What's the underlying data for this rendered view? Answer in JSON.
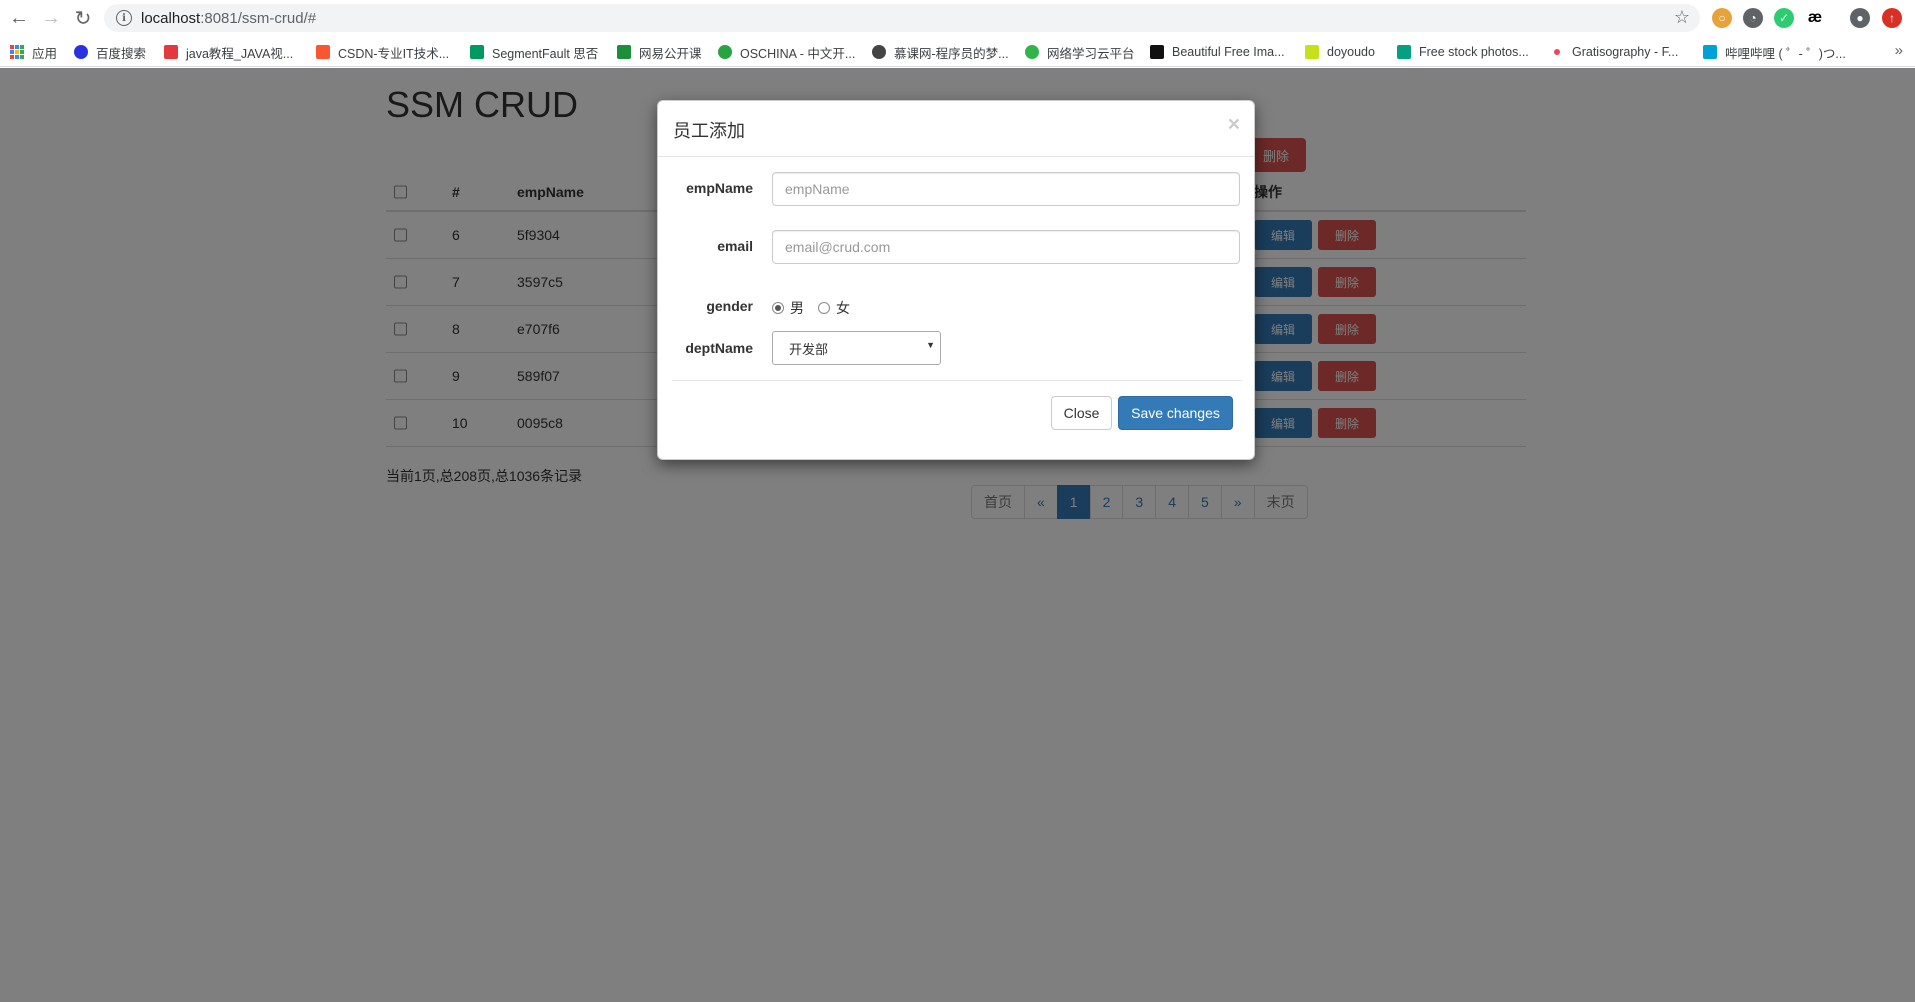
{
  "browser": {
    "url_host": "localhost",
    "url_path": ":8081/ssm-crud/#",
    "bookmarks": [
      {
        "label": "应用",
        "color": "#4285f4"
      },
      {
        "label": "百度搜索",
        "color": "#2932e1"
      },
      {
        "label": "java教程_JAVA视...",
        "color": "#e4393c"
      },
      {
        "label": "CSDN-专业IT技术...",
        "color": "#fc5531"
      },
      {
        "label": "SegmentFault 思否",
        "color": "#009a61"
      },
      {
        "label": "网易公开课",
        "color": "#1d8f3a"
      },
      {
        "label": "OSCHINA - 中文开...",
        "color": "#27a33f"
      },
      {
        "label": "慕课网-程序员的梦...",
        "color": "#444444"
      },
      {
        "label": "网络学习云平台",
        "color": "#31b44a"
      },
      {
        "label": "Beautiful Free Ima...",
        "color": "#111111"
      },
      {
        "label": "doyoudo",
        "color": "#c6e01c"
      },
      {
        "label": "Free stock photos...",
        "color": "#05a081"
      },
      {
        "label": "Gratisography - F...",
        "color": "#f0455b"
      },
      {
        "label": "哔哩哔哩 ( ゜- ゜)つ...",
        "color": "#00a1d6"
      }
    ]
  },
  "page": {
    "title": "SSM CRUD",
    "top_delete_label": "删除",
    "columns": {
      "index": "#",
      "name": "empName",
      "ops": "操作"
    },
    "rows": [
      {
        "id": "6",
        "name": "5f9304"
      },
      {
        "id": "7",
        "name": "3597c5"
      },
      {
        "id": "8",
        "name": "e707f6"
      },
      {
        "id": "9",
        "name": "589f07"
      },
      {
        "id": "10",
        "name": "0095c8"
      }
    ],
    "edit_label": "编辑",
    "delete_label": "删除",
    "info": "当前1页,总208页,总1036条记录",
    "pagination": [
      "首页",
      "«",
      "1",
      "2",
      "3",
      "4",
      "5",
      "»",
      "末页"
    ]
  },
  "modal": {
    "title": "员工添加",
    "close_symbol": "×",
    "emp_label": "empName",
    "emp_placeholder": "empName",
    "email_label": "email",
    "email_placeholder": "email@crud.com",
    "gender_label": "gender",
    "gender_male": "男",
    "gender_female": "女",
    "dept_label": "deptName",
    "dept_selected": "开发部",
    "close_button": "Close",
    "save_button": "Save changes"
  }
}
